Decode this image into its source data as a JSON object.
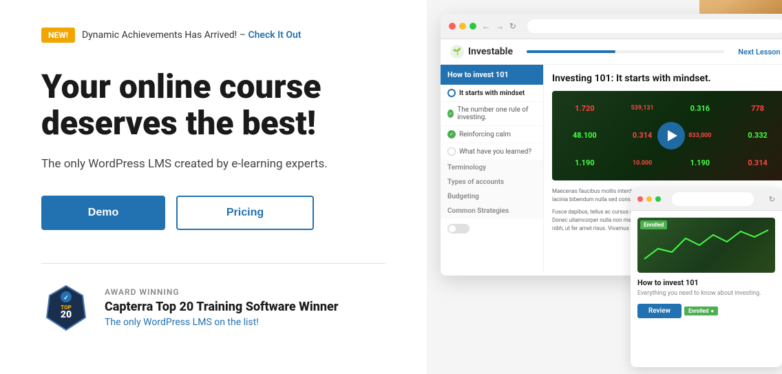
{
  "announcement": {
    "badge": "NEW!",
    "text": "Dynamic Achievements Has Arrived! –",
    "link_text": "Check It Out"
  },
  "hero": {
    "title_line1": "Your online course",
    "title_line2": "deserves the best!",
    "subtitle": "The only WordPress LMS created by e-learning experts.",
    "btn_demo": "Demo",
    "btn_pricing": "Pricing"
  },
  "award": {
    "label": "AWARD WINNING",
    "title": "Capterra Top 20 Training Software Winner",
    "subtitle": "The only WordPress LMS on the list!"
  },
  "lms": {
    "logo_name": "Investable",
    "next_lesson": "Next Lesson",
    "course_title": "How to invest 101",
    "content_title": "Investing 101: It starts with mindset.",
    "lessons": [
      {
        "label": "It starts with mindset",
        "status": "active"
      },
      {
        "label": "The number one rule of investing.",
        "status": "checked"
      },
      {
        "label": "Reinforcing calm",
        "status": "checked"
      },
      {
        "label": "What have you learned?",
        "status": "circle"
      }
    ],
    "sections": [
      "Terminology",
      "Types of accounts",
      "Budgeting",
      "Common Strategies"
    ],
    "body_text": "Maecenas faucibus mollis interdum. Praesent commodo cursus ma consectetur at. Aenean lacinia bibendum nulla sed consectetur.",
    "body_text2": "Fusce dapibus, tellus ac cursus commodo, tortor mauris condiment massa justo sit amet risus. Donec ullamcorper nulla non metus auct tellus ac cursus commodo, tortor mauris condimentum nibh, ut fer amet risus. Vivamus sagittis lacus vel augue laoreet rutrum faucibu"
  },
  "card": {
    "badge": "Enrolled",
    "title": "How to invest 101",
    "subtitle": "Everything you need to know about investing.",
    "btn_label": "Review"
  },
  "numbers": [
    {
      "val": "1.720",
      "color": "red"
    },
    {
      "val": "539,131",
      "color": "red"
    },
    {
      "val": "0.316",
      "color": "green"
    },
    {
      "val": "48.100",
      "color": "green"
    },
    {
      "val": "0.314",
      "color": "red"
    },
    {
      "val": "778",
      "color": "green"
    },
    {
      "val": "0.314",
      "color": "red"
    },
    {
      "val": "833,000",
      "color": "red"
    },
    {
      "val": "0.332",
      "color": "green"
    },
    {
      "val": "1.190",
      "color": "green"
    },
    {
      "val": "10.000",
      "color": "red"
    },
    {
      "val": "1.190",
      "color": "green"
    }
  ]
}
